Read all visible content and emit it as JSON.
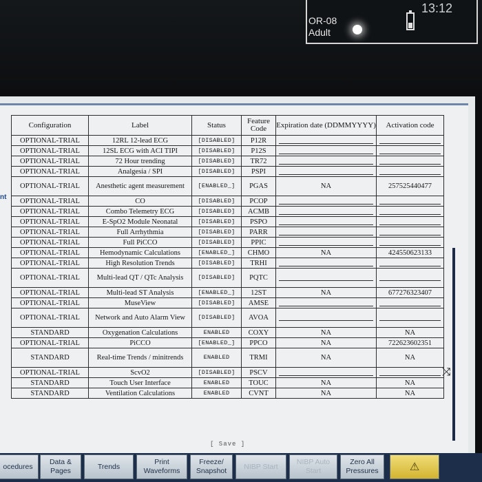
{
  "status_bar": {
    "bed": "OR-08",
    "patient_type": "Adult",
    "time": "13:12"
  },
  "side_label": "nt",
  "table": {
    "headers": [
      "Configuration",
      "Label",
      "Status",
      "Feature Code",
      "Expiration date (DDMMYYYY)",
      "Activation code"
    ],
    "rows": [
      {
        "config": "OPTIONAL-TRIAL",
        "label": "12RL 12-lead ECG",
        "status": "[DISABLED]",
        "code": "P12R",
        "expiration": "",
        "activation": ""
      },
      {
        "config": "OPTIONAL-TRIAL",
        "label": "12SL ECG with ACI TIPI",
        "status": "[DISABLED]",
        "code": "P12S",
        "expiration": "",
        "activation": ""
      },
      {
        "config": "OPTIONAL-TRIAL",
        "label": "72 Hour trending",
        "status": "[DISABLED]",
        "code": "TR72",
        "expiration": "",
        "activation": ""
      },
      {
        "config": "OPTIONAL-TRIAL",
        "label": "Analgesia / SPI",
        "status": "[DISABLED]",
        "code": "PSPI",
        "expiration": "",
        "activation": ""
      },
      {
        "config": "OPTIONAL-TRIAL",
        "label": "Anesthetic agent measurement",
        "status": "[ENABLED_]",
        "code": "PGAS",
        "expiration": "NA",
        "activation": "257525440477"
      },
      {
        "config": "OPTIONAL-TRIAL",
        "label": "CO",
        "status": "[DISABLED]",
        "code": "PCOP",
        "expiration": "",
        "activation": ""
      },
      {
        "config": "OPTIONAL-TRIAL",
        "label": "Combo Telemetry ECG",
        "status": "[DISABLED]",
        "code": "ACMB",
        "expiration": "",
        "activation": ""
      },
      {
        "config": "OPTIONAL-TRIAL",
        "label": "E-SpO2 Module Neonatal",
        "status": "[DISABLED]",
        "code": "PSPO",
        "expiration": "",
        "activation": ""
      },
      {
        "config": "OPTIONAL-TRIAL",
        "label": "Full Arrhythmia",
        "status": "[DISABLED]",
        "code": "PARR",
        "expiration": "",
        "activation": ""
      },
      {
        "config": "OPTIONAL-TRIAL",
        "label": "Full PiCCO",
        "status": "[DISABLED]",
        "code": "PPIC",
        "expiration": "",
        "activation": ""
      },
      {
        "config": "OPTIONAL-TRIAL",
        "label": "Hemodynamic Calculations",
        "status": "[ENABLED_]",
        "code": "CHMO",
        "expiration": "NA",
        "activation": "424550623133"
      },
      {
        "config": "OPTIONAL-TRIAL",
        "label": "High Resolution Trends",
        "status": "[DISABLED]",
        "code": "TRHI",
        "expiration": "",
        "activation": ""
      },
      {
        "config": "OPTIONAL-TRIAL",
        "label": "Multi-lead QT / QTc Analysis",
        "status": "[DISABLED]",
        "code": "PQTC",
        "expiration": "",
        "activation": ""
      },
      {
        "config": "OPTIONAL-TRIAL",
        "label": "Multi-lead ST Analysis",
        "status": "[ENABLED_]",
        "code": "12ST",
        "expiration": "NA",
        "activation": "677276323407"
      },
      {
        "config": "OPTIONAL-TRIAL",
        "label": "MuseView",
        "status": "[DISABLED]",
        "code": "AMSE",
        "expiration": "",
        "activation": ""
      },
      {
        "config": "OPTIONAL-TRIAL",
        "label": "Network and Auto Alarm View",
        "status": "[DISABLED]",
        "code": "AVOA",
        "expiration": "",
        "activation": ""
      },
      {
        "config": "STANDARD",
        "label": "Oxygenation Calculations",
        "status": "ENABLED",
        "code": "COXY",
        "expiration": "NA",
        "activation": "NA"
      },
      {
        "config": "OPTIONAL-TRIAL",
        "label": "PiCCO",
        "status": "[ENABLED_]",
        "code": "PPCO",
        "expiration": "NA",
        "activation": "722623602351"
      },
      {
        "config": "STANDARD",
        "label": "Real-time Trends / minitrends",
        "status": "ENABLED",
        "code": "TRMI",
        "expiration": "NA",
        "activation": "NA"
      },
      {
        "config": "OPTIONAL-TRIAL",
        "label": "ScvO2",
        "status": "[DISABLED]",
        "code": "PSCV",
        "expiration": "",
        "activation": ""
      },
      {
        "config": "STANDARD",
        "label": "Touch User Interface",
        "status": "ENABLED",
        "code": "TOUC",
        "expiration": "NA",
        "activation": "NA"
      },
      {
        "config": "STANDARD",
        "label": "Ventilation Calculations",
        "status": "ENABLED",
        "code": "CVNT",
        "expiration": "NA",
        "activation": "NA"
      }
    ]
  },
  "save_label": "[ Save ]",
  "bottom_buttons": [
    {
      "label": "ocedures",
      "enabled": true
    },
    {
      "label": "Data & Pages",
      "enabled": true
    },
    {
      "label": "Trends",
      "enabled": true
    },
    {
      "label": "Print Waveforms",
      "enabled": true
    },
    {
      "label": "Freeze/ Snapshot",
      "enabled": true
    },
    {
      "label": "NIBP Start",
      "enabled": false
    },
    {
      "label": "NIBP Auto Start",
      "enabled": false
    },
    {
      "label": "Zero All Pressures",
      "enabled": true
    },
    {
      "label": "",
      "enabled": true
    }
  ],
  "alarm_icon": "alarm-bell-icon"
}
